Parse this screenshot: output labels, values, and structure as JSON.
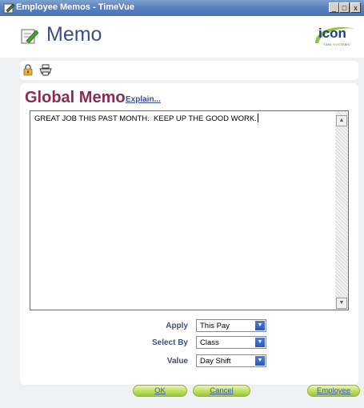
{
  "window": {
    "title": "Employee Memos - TimeVue",
    "minimize": "_",
    "maximize": "□",
    "close": "x"
  },
  "header": {
    "title": "Memo",
    "logo_word": "icon",
    "logo_sub": "TIME SYSTEMS"
  },
  "toolbar": {
    "lock_icon": "lock-icon",
    "print_icon": "printer-icon"
  },
  "memo": {
    "section_title": "Global Memo",
    "explain_link": "Explain...",
    "text": "GREAT JOB THIS PAST MONTH.  KEEP UP THE GOOD WORK."
  },
  "form": {
    "apply": {
      "label": "Apply",
      "value": "This Pay"
    },
    "select_by": {
      "label": "Select By",
      "value": "Class"
    },
    "value": {
      "label": "Value",
      "value": "Day Shift"
    }
  },
  "buttons": {
    "ok": "OK",
    "cancel": "Cancel",
    "employee": "Employee"
  },
  "colors": {
    "title_blue": "#3f4d87",
    "section_maroon": "#8b2b54",
    "button_green": "#c5e36a"
  }
}
